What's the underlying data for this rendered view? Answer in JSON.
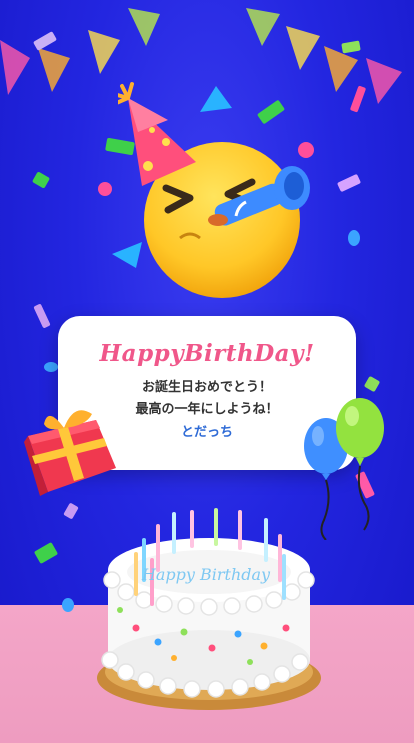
{
  "card": {
    "title": "HappyBirthDay!",
    "line1": "お誕生日おめでとう！",
    "line2": "最高の一年にしようね！",
    "signature": "とだっち"
  },
  "cake": {
    "inscription": "Happy Birthday"
  },
  "colors": {
    "background": "#2326e0",
    "floor": "#f4a6c8",
    "title_pink": "#f0578a",
    "signature_blue": "#2f6bd6"
  },
  "icons": [
    "party-emoji-icon",
    "gift-box-icon",
    "balloons-icon",
    "birthday-cake-icon",
    "pennant-banner-icon",
    "confetti-icon"
  ]
}
